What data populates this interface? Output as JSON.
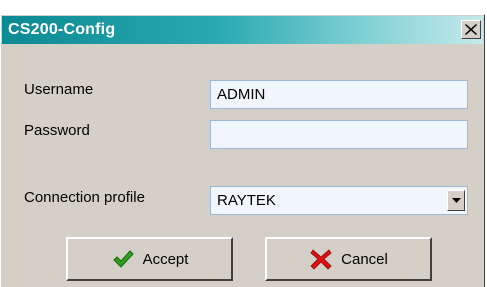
{
  "window": {
    "title": "CS200-Config",
    "close_glyph": "✕"
  },
  "form": {
    "username_label": "Username",
    "username_value": "ADMIN",
    "password_label": "Password",
    "password_value": "",
    "connection_label": "Connection profile",
    "connection_value": "RAYTEK"
  },
  "buttons": {
    "accept_label": "Accept",
    "cancel_label": "Cancel"
  },
  "colors": {
    "title_gradient_start": "#0c8a93",
    "field_background": "#f0f6fc",
    "dialog_background": "#d4d0c8",
    "accept_icon": "#2e9e1e",
    "cancel_icon": "#e01010"
  },
  "icons": {
    "close": "close-icon",
    "dropdown": "chevron-down-icon",
    "accept": "checkmark-icon",
    "cancel": "cross-icon"
  }
}
